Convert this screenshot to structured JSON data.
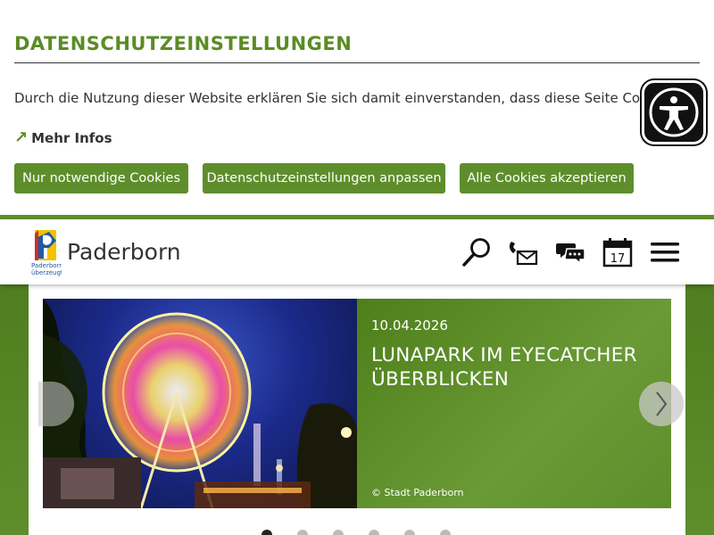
{
  "cookie_banner": {
    "title": "DATENSCHUTZEINSTELLUNGEN",
    "text": "Durch die Nutzung dieser Website erklären Sie sich damit einverstanden, dass diese Seite Cookies verwendet.",
    "more_label": "Mehr Infos",
    "buttons": {
      "necessary": "Nur notwendige Cookies",
      "customize": "Datenschutzeinstellungen anpassen",
      "accept_all": "Alle Cookies akzeptieren"
    }
  },
  "header": {
    "site_name": "Paderborn",
    "logo_text": "Paderborn überzeugt.",
    "calendar_day": "17",
    "icons": [
      "search-icon",
      "contact-icon",
      "chat-icon",
      "calendar-icon",
      "menu-icon"
    ]
  },
  "slider": {
    "date": "10.04.2026",
    "headline": "LUNAPARK IM EYECATCHER ÜBERBLICKEN",
    "credit": "© Stadt Paderborn",
    "dot_count": 6,
    "active_dot": 1
  },
  "colors": {
    "brand_green": "#5e8e2c",
    "title_green": "#5a8c24"
  }
}
